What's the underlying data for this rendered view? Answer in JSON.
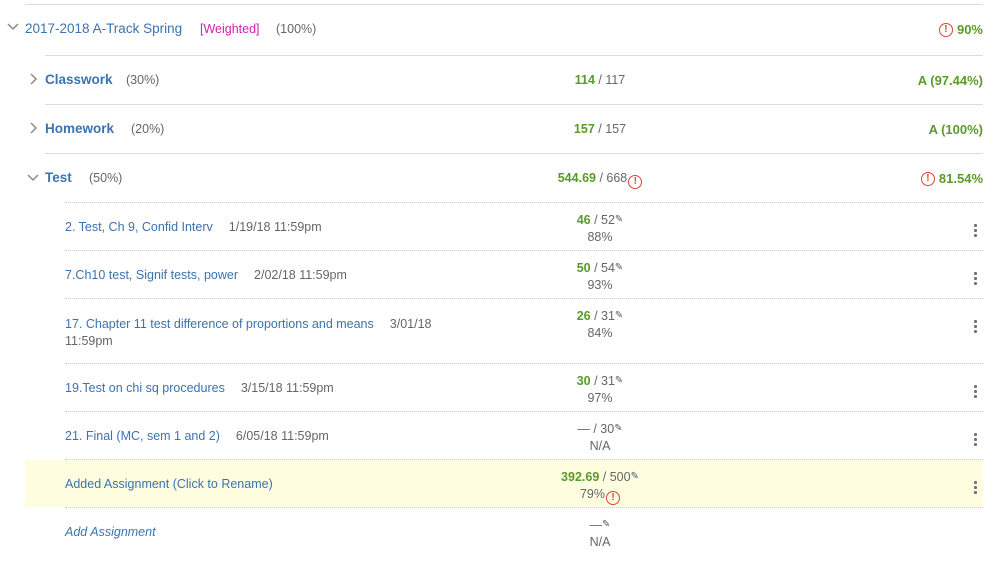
{
  "term": {
    "title": "2017-2018 A-Track Spring",
    "weighted_tag": "[Weighted]",
    "weight": "(100%)",
    "grade": "90%",
    "grade_warning": true
  },
  "categories": [
    {
      "name": "Classwork",
      "weight": "(30%)",
      "earned": "114",
      "possible": " / 117",
      "grade": "A (97.44%)",
      "expanded": false
    },
    {
      "name": "Homework",
      "weight": "(20%)",
      "earned": "157",
      "possible": " / 157",
      "grade": "A (100%)",
      "expanded": false
    },
    {
      "name": "Test",
      "weight": "(50%)",
      "earned": "544.69",
      "possible": " / 668",
      "grade": "81.54%",
      "expanded": true,
      "warning": true
    }
  ],
  "assignments": [
    {
      "name": "2. Test, Ch 9, Confid Interv",
      "due": "1/19/18 11:59pm",
      "earned": "46",
      "possible": " / 52",
      "percent": "88%"
    },
    {
      "name": "7.Ch10 test, Signif tests, power",
      "due": "2/02/18 11:59pm",
      "earned": "50",
      "possible": " / 54",
      "percent": "93%"
    },
    {
      "name": "17. Chapter 11 test difference of proportions and means",
      "due_line1": "3/01/18",
      "due_line2": "11:59pm",
      "earned": "26",
      "possible": " / 31",
      "percent": "84%"
    },
    {
      "name": "19.Test on chi sq procedures",
      "due": "3/15/18 11:59pm",
      "earned": "30",
      "possible": " / 31",
      "percent": "97%"
    },
    {
      "name": "21. Final (MC, sem 1 and 2)",
      "due": "6/05/18 11:59pm",
      "earned": "—",
      "possible": " / 30",
      "percent": "N/A"
    },
    {
      "name": "Added Assignment (Click to Rename)",
      "earned": "392.69",
      "possible": " / 500",
      "percent": "79%",
      "highlighted": true,
      "warning": true
    }
  ],
  "add_assignment": {
    "label": "Add Assignment",
    "score": "—",
    "percent": "N/A"
  },
  "icons": {
    "warning": "!",
    "pencil": "✎"
  },
  "colors": {
    "link": "#3b73af",
    "score_green": "#5a9a2a",
    "warning_red": "#d9453b",
    "weighted_magenta": "#d01fb0",
    "highlight_bg": "#fefde0"
  }
}
